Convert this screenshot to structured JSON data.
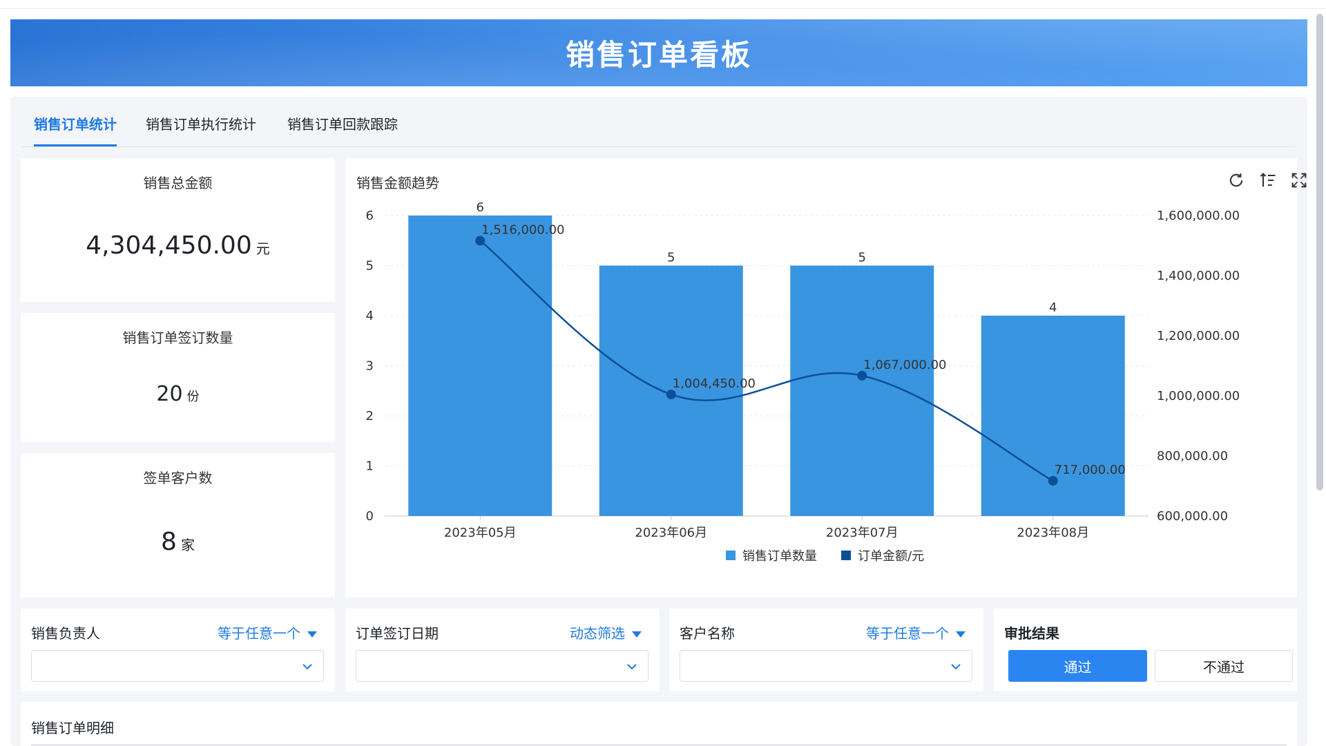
{
  "header": {
    "title": "销售订单看板"
  },
  "tabs": [
    {
      "label": "销售订单统计",
      "active": true
    },
    {
      "label": "销售订单执行统计",
      "active": false
    },
    {
      "label": "销售订单回款跟踪",
      "active": false
    }
  ],
  "kpis": [
    {
      "title": "销售总金额",
      "value": "4,304,450.00",
      "unit": "元"
    },
    {
      "title": "销售订单签订数量",
      "value": "20",
      "unit": "份"
    },
    {
      "title": "签单客户数",
      "value": "8",
      "unit": "家"
    }
  ],
  "chart_card": {
    "title": "销售金额趋势",
    "tools": [
      "refresh-icon",
      "sort-icon",
      "fullscreen-icon"
    ]
  },
  "chart_data": {
    "type": "bar",
    "categories": [
      "2023年05月",
      "2023年06月",
      "2023年07月",
      "2023年08月"
    ],
    "series": [
      {
        "name": "销售订单数量",
        "type": "bar",
        "axis": "left",
        "color": "#3a95e0",
        "values": [
          6,
          5,
          5,
          4
        ],
        "labels": [
          "6",
          "5",
          "5",
          "4"
        ]
      },
      {
        "name": "订单金额/元",
        "type": "line",
        "axis": "right",
        "color": "#0b4f96",
        "values": [
          1516000,
          1004450,
          1067000,
          717000
        ],
        "labels": [
          "1,516,000.00",
          "1,004,450.00",
          "1,067,000.00",
          "717,000.00"
        ]
      }
    ],
    "y_left": {
      "min": 0,
      "max": 6,
      "ticks": [
        "0",
        "1",
        "2",
        "3",
        "4",
        "5",
        "6"
      ]
    },
    "y_right": {
      "min": 600000,
      "max": 1600000,
      "ticks": [
        "600,000.00",
        "800,000.00",
        "1,000,000.00",
        "1,200,000.00",
        "1,400,000.00",
        "1,600,000.00"
      ]
    },
    "grid": true,
    "legend": "bottom-center"
  },
  "filters": [
    {
      "label": "销售负责人",
      "op": "等于任意一个",
      "value": ""
    },
    {
      "label": "订单签订日期",
      "op": "动态筛选",
      "value": ""
    },
    {
      "label": "客户名称",
      "op": "等于任意一个",
      "value": ""
    }
  ],
  "approval": {
    "label": "审批结果",
    "options": [
      "通过",
      "不通过"
    ],
    "selected": "通过"
  },
  "detail": {
    "title": "销售订单明细"
  },
  "colors": {
    "primary": "#1f7ae0",
    "banner_start": "#2a74d6",
    "banner_end": "#5aa3f2",
    "background": "#f3f5f9"
  }
}
